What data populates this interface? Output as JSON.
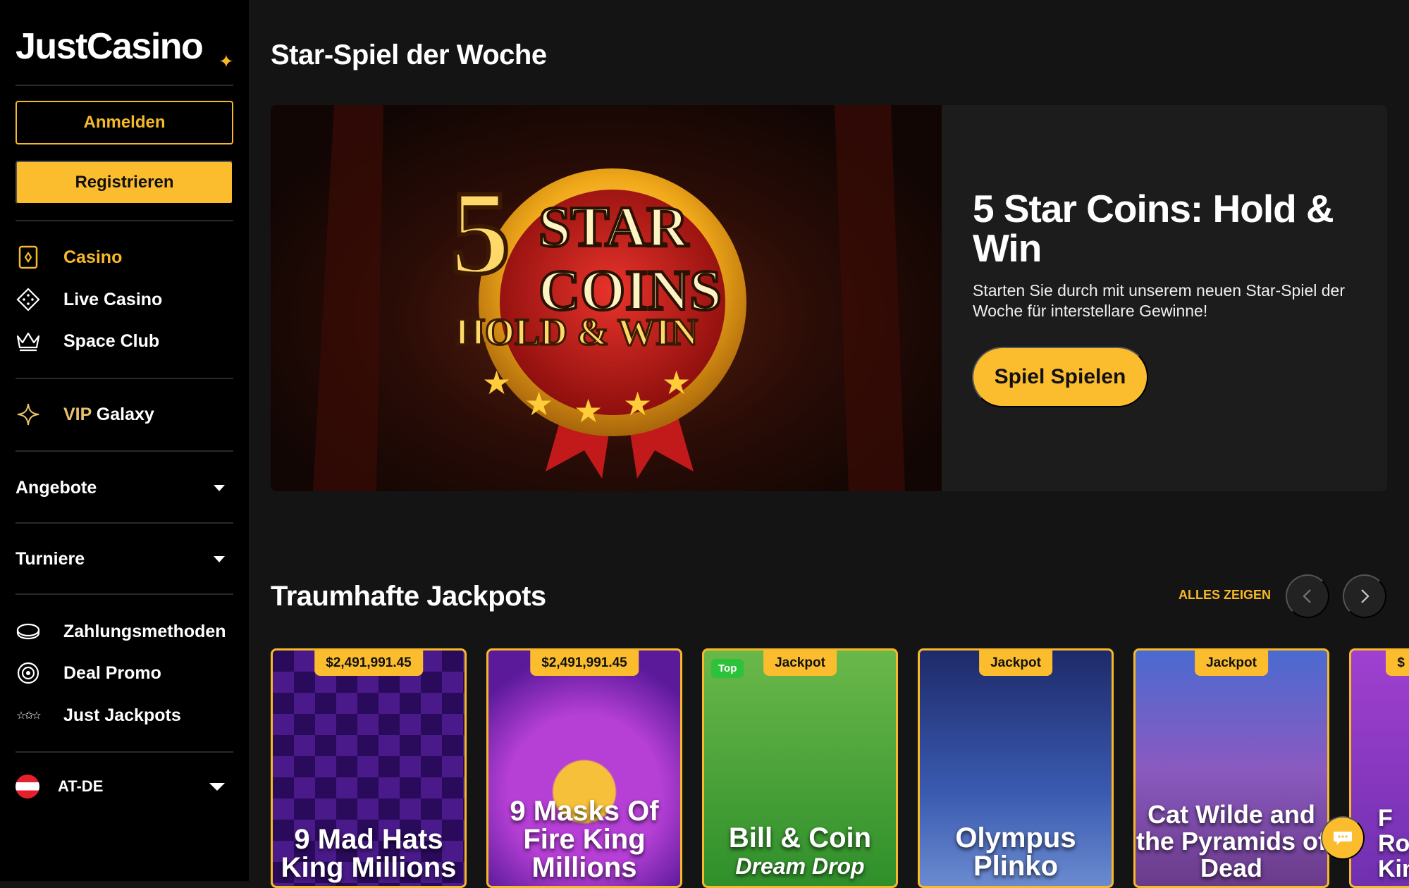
{
  "brand": {
    "name": "JustCasino",
    "accent": "#fbbd2e"
  },
  "auth": {
    "login_label": "Anmelden",
    "register_label": "Registrieren"
  },
  "nav": {
    "main": [
      {
        "label": "Casino",
        "icon": "card-icon",
        "active": true
      },
      {
        "label": "Live Casino",
        "icon": "dice-icon",
        "active": false
      },
      {
        "label": "Space Club",
        "icon": "crown-icon",
        "active": false
      }
    ],
    "vip": {
      "prefix": "VIP",
      "label": "Galaxy",
      "icon": "sparkle-icon"
    },
    "dropdowns": [
      {
        "label": "Angebote"
      },
      {
        "label": "Turniere"
      }
    ],
    "secondary": [
      {
        "label": "Zahlungsmethoden",
        "icon": "coin-icon"
      },
      {
        "label": "Deal Promo",
        "icon": "target-icon"
      },
      {
        "label": "Just Jackpots",
        "icon": "stars-icon"
      }
    ],
    "locale": {
      "label": "AT-DE",
      "icon": "austria-flag-icon"
    }
  },
  "featured": {
    "section_title": "Star-Spiel der Woche",
    "title": "5 Star Coins: Hold & Win",
    "description": "Starten Sie durch mit unserem neuen Star-Spiel der Woche für interstellare Gewinne!",
    "cta": "Spiel Spielen"
  },
  "jackpots": {
    "section_title": "Traumhafte Jackpots",
    "show_all": "ALLES ZEIGEN",
    "games": [
      {
        "badge": "$2,491,991.45",
        "title": "9 Mad Hats King Millions",
        "top": false
      },
      {
        "badge": "$2,491,991.45",
        "title": "9 Masks Of Fire King Millions",
        "top": false
      },
      {
        "badge": "Jackpot",
        "title": "Bill & Coin",
        "subtitle": "Dream Drop",
        "top": true,
        "top_label": "Top"
      },
      {
        "badge": "Jackpot",
        "title": "Olympus Plinko",
        "top": false
      },
      {
        "badge": "Jackpot",
        "title": "Cat Wilde and the Pyramids of Dead",
        "top": false
      },
      {
        "badge": "$",
        "title": "F Ros Kin",
        "top": false
      }
    ]
  }
}
